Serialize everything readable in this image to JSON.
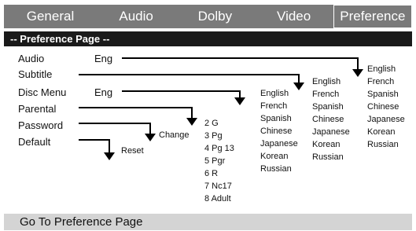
{
  "tabs": [
    "General",
    "Audio",
    "Dolby",
    "Video",
    "Preference"
  ],
  "active_tab": "Preference",
  "page_header": "-- Preference Page --",
  "menu": {
    "audio": {
      "label": "Audio",
      "value": "Eng"
    },
    "subtitle": {
      "label": "Subtitle"
    },
    "disc_menu": {
      "label": "Disc Menu",
      "value": "Eng"
    },
    "parental": {
      "label": "Parental"
    },
    "password": {
      "label": "Password",
      "action": "Change"
    },
    "default": {
      "label": "Default",
      "action": "Reset"
    }
  },
  "options": {
    "parental": [
      "2 G",
      "3 Pg",
      "4 Pg 13",
      "5 Pgr",
      "6 R",
      "7 Nc17",
      "8 Adult"
    ],
    "disc_menu": [
      "English",
      "French",
      "Spanish",
      "Chinese",
      "Japanese",
      "Korean",
      "Russian"
    ],
    "subtitle": [
      "English",
      "French",
      "Spanish",
      "Chinese",
      "Japanese",
      "Korean",
      "Russian"
    ],
    "audio": [
      "English",
      "French",
      "Spanish",
      "Chinese",
      "Japanese",
      "Korean",
      "Russian"
    ]
  },
  "footer": "Go To Preference Page"
}
